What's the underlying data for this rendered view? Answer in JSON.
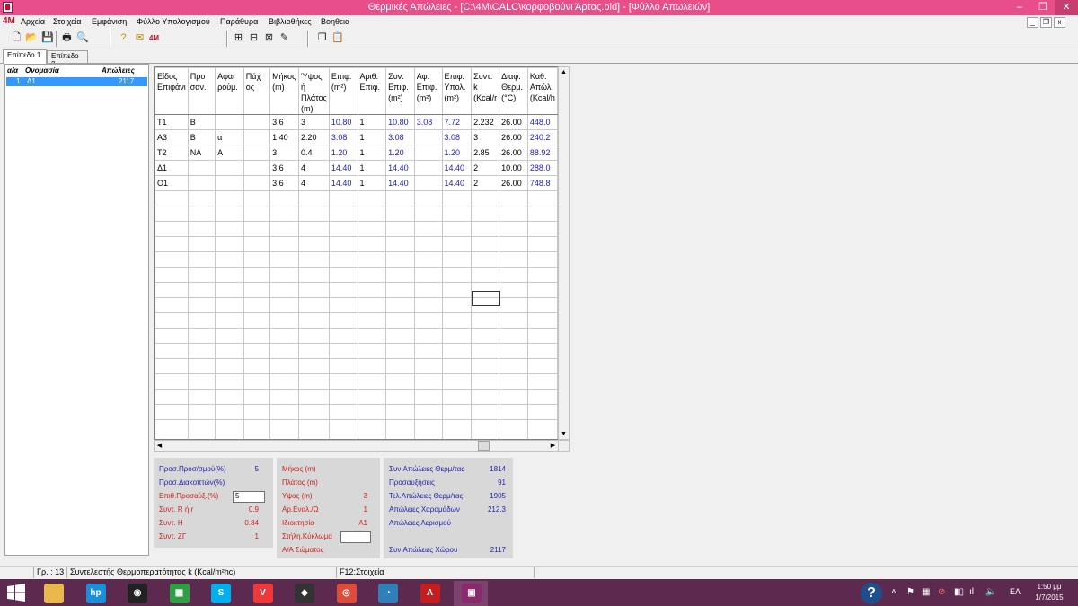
{
  "window": {
    "title": "Θερμικές Απώλειες - [C:\\4M\\CALC\\κορφοβούνι Άρτας.bld] - [Φύλλο Απωλειών]",
    "controls": [
      "–",
      "❐",
      "✕"
    ]
  },
  "menu": {
    "logo": "4M",
    "items": [
      "Αρχεία",
      "Στοιχεία",
      "Εμφάνιση",
      "Φύλλο Υπολογισμού",
      "Παράθυρα",
      "Βιβλιοθήκες",
      "Βοηθεια"
    ],
    "mdi_controls": [
      "_",
      "❐",
      "x"
    ]
  },
  "toolbar": {
    "icons": [
      "new-file-icon",
      "open-folder-icon",
      "save-icon",
      "print-icon",
      "print-preview-icon",
      "help-icon",
      "mail-icon",
      "4m-logo-icon",
      "insert-row-icon",
      "insert-row-before-icon",
      "delete-row-icon",
      "edit-row-icon",
      "copy-icon",
      "paste-icon"
    ],
    "logo_text": "4M"
  },
  "tabs": [
    "Επίπεδο 1",
    "Επίπεδο 2"
  ],
  "list": {
    "headers": [
      "α/α",
      "Ονομασία",
      "Απώλειες"
    ],
    "rows": [
      {
        "aa": "1",
        "name": "Δ1",
        "loss": "2117"
      }
    ]
  },
  "grid": {
    "headers": [
      "Είδος Επιφάνι",
      "Προ σαν.",
      "Αφαι ρούμ.",
      "Πάχ ος",
      "Μήκος (m)",
      "Ύψος ή Πλάτος (m)",
      "Επιφ. (m²)",
      "Αριθ. Επιφ.",
      "Συν. Επιφ. (m²)",
      "Αφ. Επιφ. (m²)",
      "Επιφ. Υπολ. (m²)",
      "Συντ. k (Kcal/r",
      "Διαφ. Θερμ. (°C)",
      "Καθ. Απώλ. (Kcal/h"
    ],
    "rows": [
      [
        "Τ1",
        "Β",
        "",
        "",
        "3.6",
        "3",
        "10.80",
        "1",
        "10.80",
        "3.08",
        "7.72",
        "2.232",
        "26.00",
        "448.0"
      ],
      [
        "Α3",
        "Β",
        "α",
        "",
        "1.40",
        "2.20",
        "3.08",
        "1",
        "3.08",
        "",
        "3.08",
        "3",
        "26.00",
        "240.2"
      ],
      [
        "Τ2",
        "ΝΑ",
        "Α",
        "",
        "3",
        "0.4",
        "1.20",
        "1",
        "1.20",
        "",
        "1.20",
        "2.85",
        "26.00",
        "88.92"
      ],
      [
        "Δ1",
        "",
        "",
        "",
        "3.6",
        "4",
        "14.40",
        "1",
        "14.40",
        "",
        "14.40",
        "2",
        "10.00",
        "288.0"
      ],
      [
        "Ο1",
        "",
        "",
        "",
        "3.6",
        "4",
        "14.40",
        "1",
        "14.40",
        "",
        "14.40",
        "2",
        "26.00",
        "748.8"
      ]
    ],
    "blue_columns": [
      6,
      8,
      9,
      10,
      13
    ],
    "empty_rows": 17
  },
  "panel_left": [
    {
      "label": "Προσ.Προσ/σμού(%)",
      "value": "5",
      "color": "blue"
    },
    {
      "label": "Προσ.Διακοπτών(%)",
      "value": "",
      "color": "blue"
    },
    {
      "label": "Επιθ.Προσαύξ.(%)",
      "value": "5",
      "color": "red",
      "input": true
    },
    {
      "label": "Συντ. R ή r",
      "value": "0.9",
      "color": "red"
    },
    {
      "label": "Συντ. Η",
      "value": "0.84",
      "color": "red"
    },
    {
      "label": "Συντ. ΖΓ",
      "value": "1",
      "color": "red"
    }
  ],
  "panel_mid": [
    {
      "label": "Μήκος (m)",
      "value": ""
    },
    {
      "label": "Πλάτος (m)",
      "value": ""
    },
    {
      "label": "Υψος (m)",
      "value": "3"
    },
    {
      "label": "Αρ.Εναλ./Ω",
      "value": "1"
    },
    {
      "label": "Ιδιοκτησία",
      "value": "Α1"
    },
    {
      "label": "Στήλη.Κύκλωμα",
      "value": "",
      "input": true
    },
    {
      "label": "Α/Α Σώματος",
      "value": ""
    }
  ],
  "panel_right": [
    {
      "label": "Συν.Απώλειες Θερμ/τας",
      "value": "1814"
    },
    {
      "label": "Προσαυξήσεις",
      "value": "91"
    },
    {
      "label": "Τελ.Απώλειες Θερμ/τας",
      "value": "1905"
    },
    {
      "label": "Απώλειες Χαραμάδων",
      "value": "212.3"
    },
    {
      "label": "Απώλειες Αερισμού",
      "value": ""
    },
    {
      "label": "",
      "value": ""
    },
    {
      "label": "Συν.Απώλειες Χώρου",
      "value": "2117"
    }
  ],
  "status": {
    "row_info": "Γρ. : 13",
    "message": "Συντελεστής Θερμοπερατότητας k (Kcal/m²hc)",
    "hint": "F12:Στοιχεία"
  },
  "taskbar": {
    "apps": [
      {
        "name": "file-explorer-icon",
        "color": "#e8b84a",
        "text": ""
      },
      {
        "name": "hp-icon",
        "color": "#1a8fd8",
        "text": "hp"
      },
      {
        "name": "camera-app-icon",
        "color": "#222222",
        "text": "◉"
      },
      {
        "name": "store-icon",
        "color": "#2ea043",
        "text": "▦"
      },
      {
        "name": "skype-icon",
        "color": "#00aff0",
        "text": "S"
      },
      {
        "name": "vivaldi-icon",
        "color": "#ef3939",
        "text": "V"
      },
      {
        "name": "wolf-app-icon",
        "color": "#333333",
        "text": "◆"
      },
      {
        "name": "chrome-icon",
        "color": "#dd4b39",
        "text": "◎"
      },
      {
        "name": "speedometer-icon",
        "color": "#2f7fb8",
        "text": "◔"
      },
      {
        "name": "acrobat-icon",
        "color": "#c41e1e",
        "text": "A"
      },
      {
        "name": "active-app-icon",
        "color": "#8a2a6e",
        "text": "▣"
      }
    ],
    "tray": {
      "language": "ΕΛ",
      "time": "1:50 μμ",
      "date": "1/7/2015"
    }
  }
}
